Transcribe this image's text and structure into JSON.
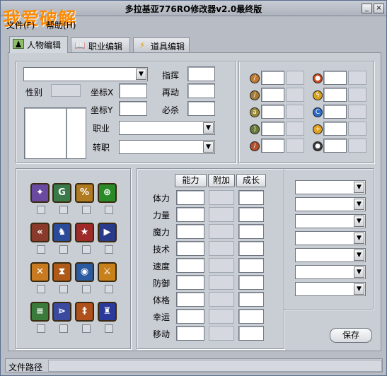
{
  "window": {
    "title": "多拉基亚776RO修改器v2.0最终版",
    "watermark": "我爱破解"
  },
  "menu": {
    "file": "文件(F)",
    "help": "帮助(H)"
  },
  "tabs": [
    {
      "label": "人物编辑",
      "icon": "character-icon"
    },
    {
      "label": "职业编辑",
      "icon": "book-icon"
    },
    {
      "label": "道具编辑",
      "icon": "lightning-icon"
    }
  ],
  "character": {
    "name_select": "",
    "gender_label": "性别",
    "coord_x_label": "坐标X",
    "coord_y_label": "坐标Y",
    "command_label": "指挥",
    "move_again_label": "再动",
    "crit_label": "必杀",
    "class_label": "职业",
    "class_change_label": "转职"
  },
  "stats": {
    "headers": [
      "能力",
      "附加",
      "成长"
    ],
    "rows": [
      "体力",
      "力量",
      "魔力",
      "技术",
      "速度",
      "防御",
      "体格",
      "幸运",
      "移动"
    ]
  },
  "save_label": "保存",
  "status": {
    "path_label": "文件路径",
    "path_value": ""
  },
  "colors": {
    "accent": "#ff8a00",
    "panel": "#c9cdd4",
    "frame": "#b8bcc4"
  }
}
